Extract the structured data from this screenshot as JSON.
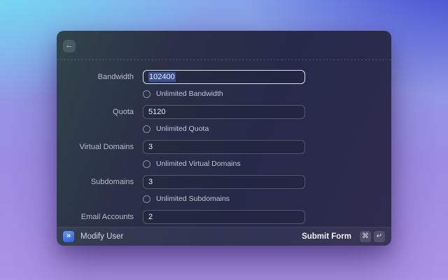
{
  "window": {
    "back_icon": "←",
    "form": {
      "fields": [
        {
          "label": "Bandwidth",
          "value": "102400",
          "state": "focused-selected",
          "checkbox": "Unlimited Bandwidth"
        },
        {
          "label": "Quota",
          "value": "5120",
          "state": "normal",
          "checkbox": "Unlimited Quota"
        },
        {
          "label": "Virtual Domains",
          "value": "3",
          "state": "normal",
          "checkbox": "Unlimited Virtual Domains"
        },
        {
          "label": "Subdomains",
          "value": "3",
          "state": "normal",
          "checkbox": "Unlimited Subdomains"
        },
        {
          "label": "Email Accounts",
          "value": "2",
          "state": "normal",
          "checkbox": null
        }
      ],
      "checkboxes_checked": [
        false,
        false,
        false,
        false
      ]
    },
    "footer": {
      "app_icon": "»",
      "app_name": "Modify User",
      "primary_action": "Submit Form",
      "shortcut_keys": [
        "⌘",
        "↵"
      ]
    },
    "colors": {
      "selection_highlight": "#486ee0",
      "focused_border": "#d9dade",
      "app_badge_blue": "#3b6be0",
      "desktop_cyan": "#70e5f4",
      "desktop_indigo": "#3b3ccd",
      "desktop_purple": "#a78ee2"
    }
  }
}
